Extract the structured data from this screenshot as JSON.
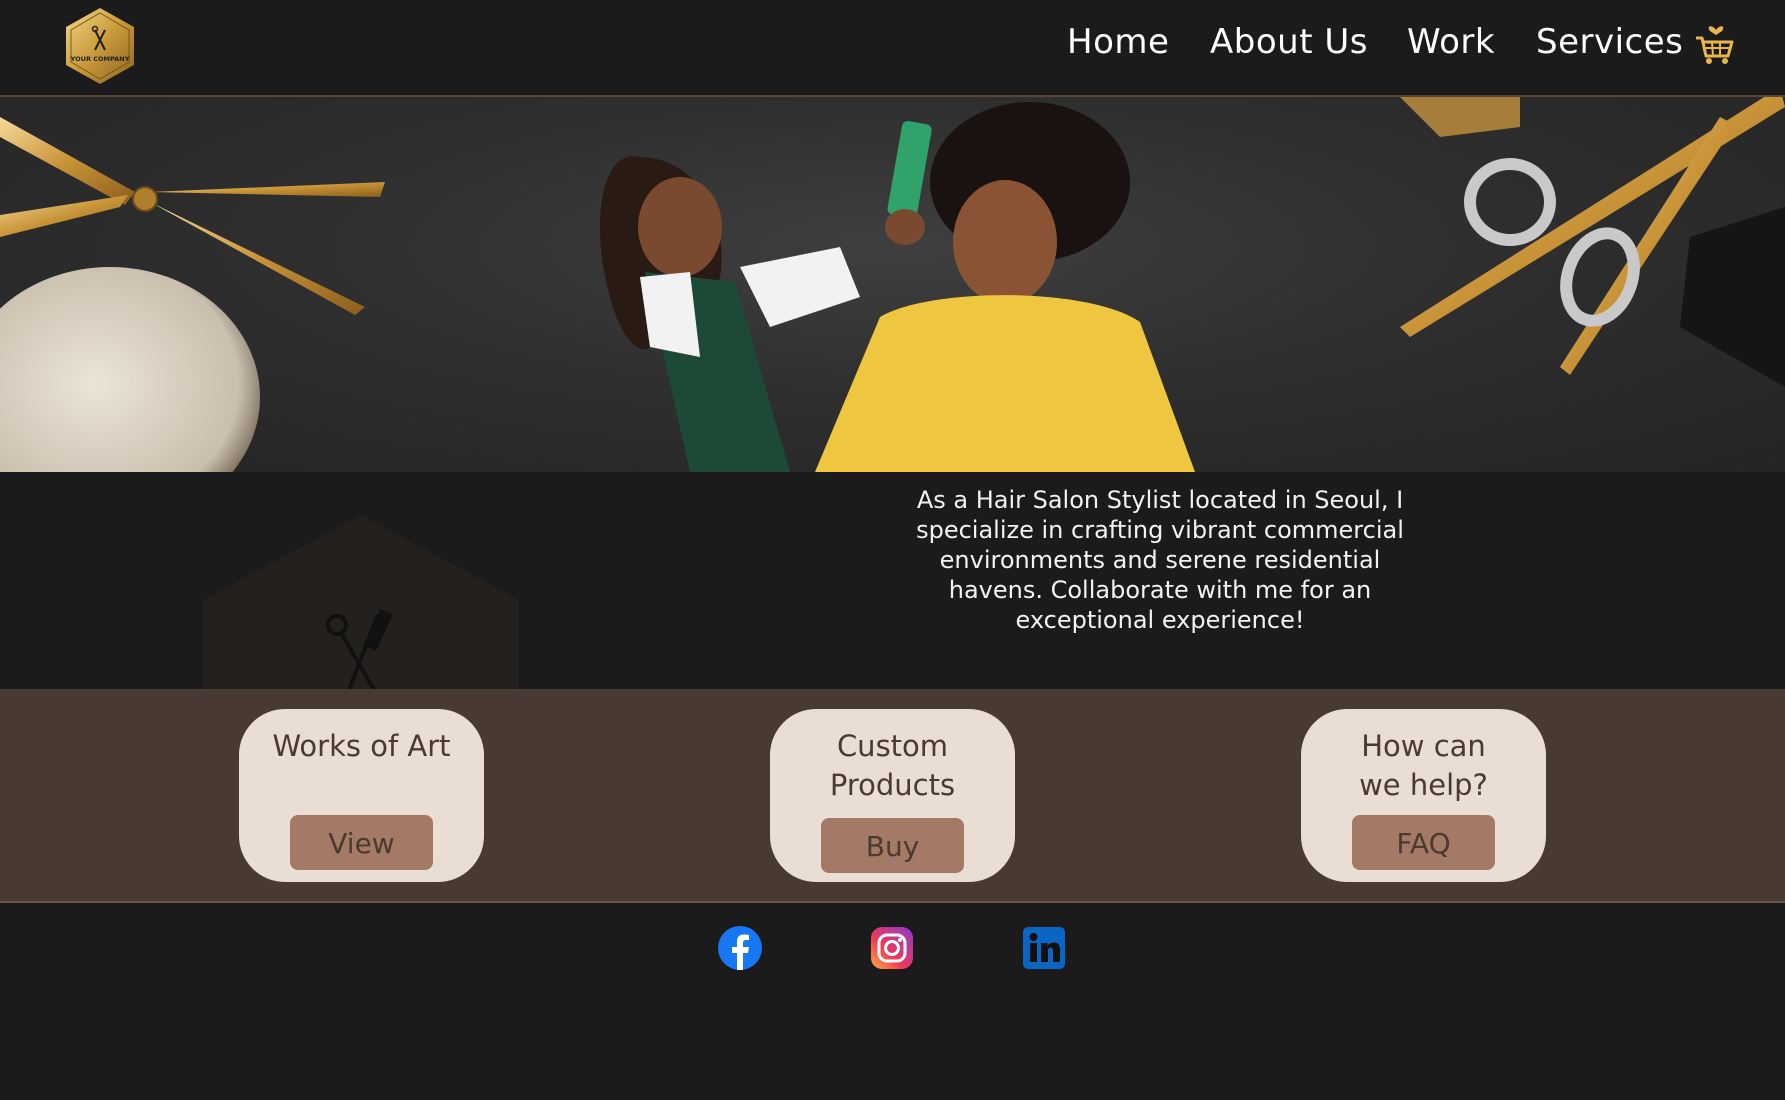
{
  "header": {
    "logo_text": "YOUR COMPANY",
    "nav": [
      {
        "label": "Home"
      },
      {
        "label": "About Us"
      },
      {
        "label": "Work"
      },
      {
        "label": "Services"
      }
    ],
    "cart_icon": "shopping-cart-icon"
  },
  "hero": {
    "image": "stylist-combing-client-hair-photo"
  },
  "intro": {
    "text": "As a Hair Salon Stylist located in Seoul, I specialize in crafting vibrant commercial environments and serene residential havens. Collaborate with me for an exceptional experience!"
  },
  "cards": [
    {
      "title": "Works of Art",
      "button": "View"
    },
    {
      "title": "Custom Products",
      "button": "Buy"
    },
    {
      "title": "How can we help?",
      "button": "FAQ"
    }
  ],
  "social": [
    {
      "icon": "facebook-icon"
    },
    {
      "icon": "instagram-icon"
    },
    {
      "icon": "linkedin-icon"
    }
  ],
  "colors": {
    "background": "#1b1b1b",
    "band": "#483a33",
    "card": "#eaded4",
    "button": "#a47966",
    "gold": "#d4a84a"
  }
}
